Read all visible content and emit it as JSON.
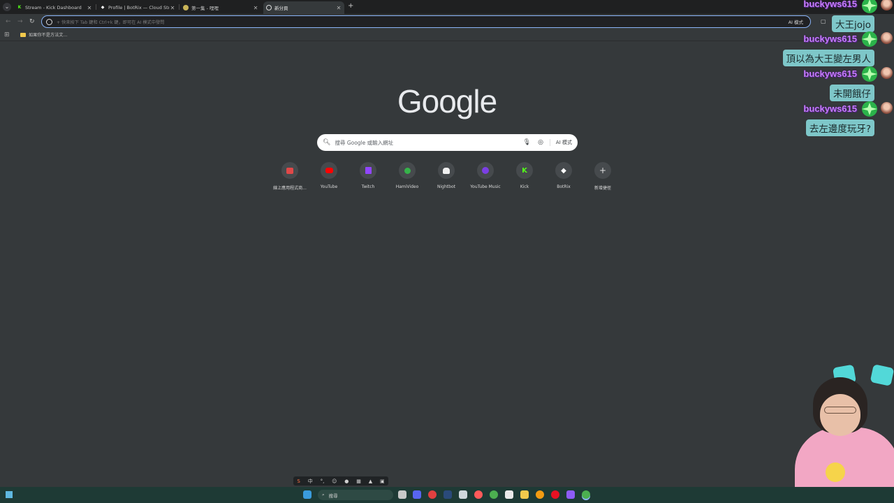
{
  "browser": {
    "tabs": [
      {
        "title": "Stream - Kick Dashboard",
        "favicon": "kick-icon",
        "active": false
      },
      {
        "title": "Profile | BotRix — Cloud Strea",
        "favicon": "botrix-icon",
        "active": false
      },
      {
        "title": "第一集 - 哩哩",
        "favicon": "video-icon",
        "active": false
      },
      {
        "title": "新分頁",
        "favicon": "google-icon",
        "active": true
      }
    ],
    "omnibox": {
      "placeholder": "+ 快來按下 Tab 鍵和 Ctrl+k 鍵，即可在 AI 模式中發問",
      "ai_label": "AI 模式"
    },
    "bookmark": "如果你不是方法文..."
  },
  "ntp": {
    "logo": "Google",
    "search_placeholder": "搜尋 Google 或輸入網址",
    "ai_mode_label": "AI 模式",
    "shortcuts": [
      {
        "label": "線上應用程式商...",
        "icon": "web-store-icon",
        "color": "#e04848"
      },
      {
        "label": "YouTube",
        "icon": "youtube-icon",
        "color": "#ff0000"
      },
      {
        "label": "Twitch",
        "icon": "twitch-icon",
        "color": "#9146ff"
      },
      {
        "label": "HamiVideo",
        "icon": "hamivideo-icon",
        "color": "#36b34a"
      },
      {
        "label": "Nightbot",
        "icon": "nightbot-icon",
        "color": "#f0f0f0"
      },
      {
        "label": "YouTube Music",
        "icon": "youtube-music-icon",
        "color": "#7b3fe4"
      },
      {
        "label": "Kick",
        "icon": "kick-icon",
        "color": "#53fc18"
      },
      {
        "label": "BotRix",
        "icon": "botrix-icon",
        "color": "#ffffff"
      },
      {
        "label": "新增捷徑",
        "icon": "plus-icon",
        "color": "#e3e3e3"
      }
    ]
  },
  "chat": [
    {
      "user": "buckyws615",
      "message": "大王jojo"
    },
    {
      "user": "buckyws615",
      "message": "頂以為大王變左男人"
    },
    {
      "user": "buckyws615",
      "message": "未開餓仔"
    },
    {
      "user": "buckyws615",
      "message": "去左邊度玩牙?"
    }
  ],
  "taskbar": {
    "search_label": "搜尋"
  }
}
